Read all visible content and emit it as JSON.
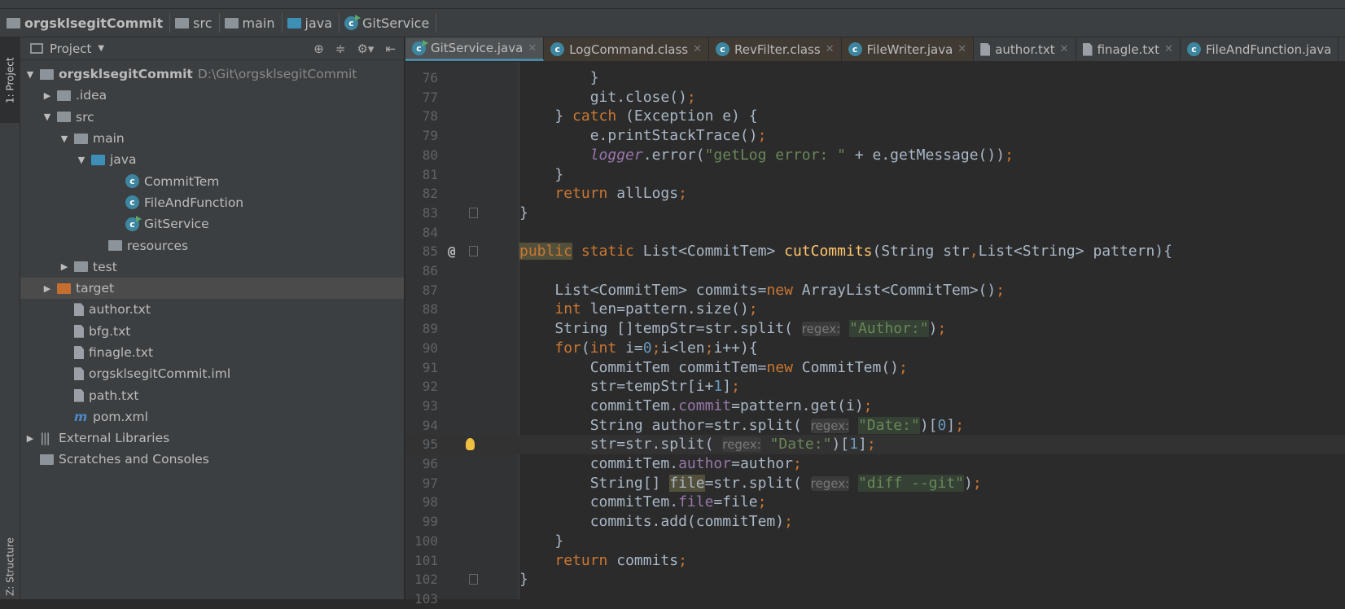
{
  "breadcrumb": [
    {
      "label": "orgsklsegitCommit",
      "icon": "module-folder-icon"
    },
    {
      "label": "src",
      "icon": "folder-icon"
    },
    {
      "label": "main",
      "icon": "folder-icon"
    },
    {
      "label": "java",
      "icon": "source-folder-icon"
    },
    {
      "label": "GitService",
      "icon": "class-icon"
    }
  ],
  "sidebar": {
    "project_tab": "1: Project",
    "structure_tab": "Z: Structure"
  },
  "panel": {
    "title": "Project",
    "tree": [
      {
        "label": "orgsklsegitCommit",
        "path": "D:\\Git\\orgsklsegitCommit",
        "level": 0,
        "arrow": "▼",
        "icon": "module",
        "bold": true
      },
      {
        "label": ".idea",
        "level": 1,
        "arrow": "▶",
        "icon": "folder"
      },
      {
        "label": "src",
        "level": 1,
        "arrow": "▼",
        "icon": "folder"
      },
      {
        "label": "main",
        "level": 2,
        "arrow": "▼",
        "icon": "folder"
      },
      {
        "label": "java",
        "level": 3,
        "arrow": "▼",
        "icon": "folder-blue"
      },
      {
        "label": "CommitTem",
        "level": 5,
        "icon": "class"
      },
      {
        "label": "FileAndFunction",
        "level": 5,
        "icon": "class"
      },
      {
        "label": "GitService",
        "level": 5,
        "icon": "class-run"
      },
      {
        "label": "resources",
        "level": 4,
        "icon": "folder"
      },
      {
        "label": "test",
        "level": 2,
        "arrow": "▶",
        "icon": "folder"
      },
      {
        "label": "target",
        "level": 1,
        "arrow": "▶",
        "icon": "folder-orange",
        "selected": true
      },
      {
        "label": "author.txt",
        "level": 2,
        "icon": "txt"
      },
      {
        "label": "bfg.txt",
        "level": 2,
        "icon": "txt"
      },
      {
        "label": "finagle.txt",
        "level": 2,
        "icon": "txt"
      },
      {
        "label": "orgsklsegitCommit.iml",
        "level": 2,
        "icon": "txt"
      },
      {
        "label": "path.txt",
        "level": 2,
        "icon": "txt"
      },
      {
        "label": "pom.xml",
        "level": 2,
        "icon": "maven"
      },
      {
        "label": "External Libraries",
        "level": 0,
        "arrow": "▶",
        "icon": "lib"
      },
      {
        "label": "Scratches and Consoles",
        "level": 0,
        "icon": "scratch"
      }
    ]
  },
  "tabs": [
    {
      "label": "GitService.java",
      "icon": "class-run",
      "active": true
    },
    {
      "label": "LogCommand.class",
      "icon": "class-locked",
      "ro": true
    },
    {
      "label": "RevFilter.class",
      "icon": "class-locked",
      "ro": true
    },
    {
      "label": "FileWriter.java",
      "icon": "class-locked",
      "ro": true
    },
    {
      "label": "author.txt",
      "icon": "txt"
    },
    {
      "label": "finagle.txt",
      "icon": "txt"
    },
    {
      "label": "FileAndFunction.java",
      "icon": "class"
    }
  ],
  "editor": {
    "lines": [
      {
        "n": "76",
        "t": [
          [
            "pl",
            "        }"
          ]
        ]
      },
      {
        "n": "77",
        "t": [
          [
            "pl",
            "        git.close()"
          ],
          [
            "kw",
            ";"
          ]
        ]
      },
      {
        "n": "78",
        "t": [
          [
            "pl",
            "    } "
          ],
          [
            "kw",
            "catch"
          ],
          [
            "pl",
            " (Exception e) {"
          ]
        ]
      },
      {
        "n": "79",
        "t": [
          [
            "pl",
            "        e.printStackTrace()"
          ],
          [
            "kw",
            ";"
          ]
        ]
      },
      {
        "n": "80",
        "t": [
          [
            "pl",
            "        "
          ],
          [
            "ital",
            "logger"
          ],
          [
            "pl",
            ".error("
          ],
          [
            "str",
            "\"getLog error: \""
          ],
          [
            "pl",
            " + e.getMessage())"
          ],
          [
            "kw",
            ";"
          ]
        ]
      },
      {
        "n": "81",
        "t": [
          [
            "pl",
            "    }"
          ]
        ]
      },
      {
        "n": "82",
        "t": [
          [
            "pl",
            "    "
          ],
          [
            "kw",
            "return"
          ],
          [
            "pl",
            " allLogs"
          ],
          [
            "kw",
            ";"
          ]
        ]
      },
      {
        "n": "83",
        "t": [
          [
            "pl",
            "}"
          ]
        ],
        "fold": true
      },
      {
        "n": "84",
        "t": []
      },
      {
        "n": "85",
        "t": [
          [
            "kw hlw",
            "public"
          ],
          [
            "kw",
            " static"
          ],
          [
            "pl",
            " List<CommitTem> "
          ],
          [
            "fn",
            "cutCommits"
          ],
          [
            "pl",
            "(String str"
          ],
          [
            "kw",
            ","
          ],
          [
            "pl",
            "List<String> pattern){"
          ]
        ],
        "at": true,
        "fold": true
      },
      {
        "n": "86",
        "t": []
      },
      {
        "n": "87",
        "t": [
          [
            "pl",
            "    List<CommitTem> commits="
          ],
          [
            "kw",
            "new"
          ],
          [
            "pl",
            " ArrayList<CommitTem>()"
          ],
          [
            "kw",
            ";"
          ]
        ]
      },
      {
        "n": "88",
        "t": [
          [
            "pl",
            "    "
          ],
          [
            "kw",
            "int"
          ],
          [
            "pl",
            " len=pattern.size()"
          ],
          [
            "kw",
            ";"
          ]
        ]
      },
      {
        "n": "89",
        "t": [
          [
            "pl",
            "    String []tempStr=str.split( "
          ],
          [
            "hint",
            "regex:"
          ],
          [
            "pl",
            " "
          ],
          [
            "str hl",
            "\"Author:\""
          ],
          [
            "pl",
            ")"
          ],
          [
            "kw",
            ";"
          ]
        ]
      },
      {
        "n": "90",
        "t": [
          [
            "pl",
            "    "
          ],
          [
            "kw",
            "for"
          ],
          [
            "pl",
            "("
          ],
          [
            "kw",
            "int"
          ],
          [
            "pl",
            " i="
          ],
          [
            "num",
            "0"
          ],
          [
            "kw",
            ";"
          ],
          [
            "pl",
            "i<len"
          ],
          [
            "kw",
            ";"
          ],
          [
            "pl",
            "i++){"
          ]
        ]
      },
      {
        "n": "91",
        "t": [
          [
            "pl",
            "        CommitTem commitTem="
          ],
          [
            "kw",
            "new"
          ],
          [
            "pl",
            " CommitTem()"
          ],
          [
            "kw",
            ";"
          ]
        ]
      },
      {
        "n": "92",
        "t": [
          [
            "pl",
            "        str=tempStr[i+"
          ],
          [
            "num",
            "1"
          ],
          [
            "pl",
            "]"
          ],
          [
            "kw",
            ";"
          ]
        ]
      },
      {
        "n": "93",
        "t": [
          [
            "pl",
            "        commitTem."
          ],
          [
            "fld",
            "commit"
          ],
          [
            "pl",
            "=pattern.get(i)"
          ],
          [
            "kw",
            ";"
          ]
        ]
      },
      {
        "n": "94",
        "t": [
          [
            "pl",
            "        String author=str.split( "
          ],
          [
            "hint",
            "regex:"
          ],
          [
            "pl",
            " "
          ],
          [
            "str hl",
            "\"Date:\""
          ],
          [
            "pl",
            ")["
          ],
          [
            "num",
            "0"
          ],
          [
            "pl",
            "]"
          ],
          [
            "kw",
            ";"
          ]
        ]
      },
      {
        "n": "95",
        "t": [
          [
            "pl",
            "        str=str.split( "
          ],
          [
            "hint",
            "regex:"
          ],
          [
            "pl",
            " "
          ],
          [
            "str",
            "\"Date:\""
          ],
          [
            "pl",
            ")["
          ],
          [
            "num",
            "1"
          ],
          [
            "pl",
            "]"
          ],
          [
            "kw",
            ";"
          ]
        ],
        "cur": true,
        "bulb": true
      },
      {
        "n": "96",
        "t": [
          [
            "pl",
            "        commitTem."
          ],
          [
            "fld",
            "author"
          ],
          [
            "pl",
            "=author"
          ],
          [
            "kw",
            ";"
          ]
        ]
      },
      {
        "n": "97",
        "t": [
          [
            "pl",
            "        String[] "
          ],
          [
            "pl hlw",
            "file"
          ],
          [
            "pl",
            "=str.split( "
          ],
          [
            "hint",
            "regex:"
          ],
          [
            "pl",
            " "
          ],
          [
            "str hl",
            "\"diff --git\""
          ],
          [
            "pl",
            ")"
          ],
          [
            "kw",
            ";"
          ]
        ]
      },
      {
        "n": "98",
        "t": [
          [
            "pl",
            "        commitTem."
          ],
          [
            "fld",
            "file"
          ],
          [
            "pl",
            "=file"
          ],
          [
            "kw",
            ";"
          ]
        ]
      },
      {
        "n": "99",
        "t": [
          [
            "pl",
            "        commits.add(commitTem)"
          ],
          [
            "kw",
            ";"
          ]
        ]
      },
      {
        "n": "100",
        "t": [
          [
            "pl",
            "    }"
          ]
        ]
      },
      {
        "n": "101",
        "t": [
          [
            "pl",
            "    "
          ],
          [
            "kw",
            "return"
          ],
          [
            "pl",
            " commits"
          ],
          [
            "kw",
            ";"
          ]
        ]
      },
      {
        "n": "102",
        "t": [
          [
            "pl",
            "}"
          ]
        ],
        "fold": true
      },
      {
        "n": "103",
        "t": []
      }
    ]
  },
  "colors": {
    "background": "#2b2b2b",
    "panel": "#3c3f41",
    "keyword": "#cc7832",
    "string": "#6a8759",
    "accent": "#4a88a4"
  }
}
